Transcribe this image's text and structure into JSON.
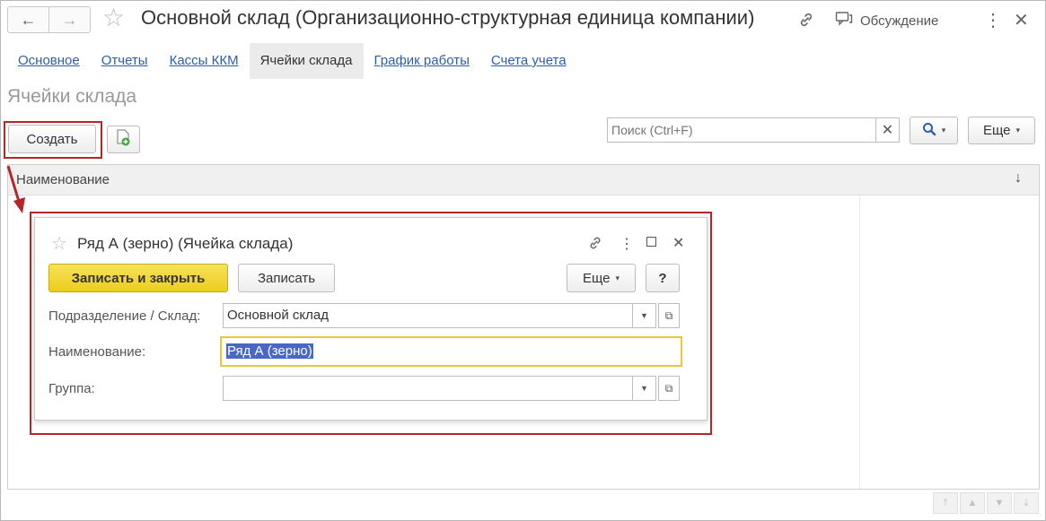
{
  "window": {
    "title": "Основной склад (Организационно-структурная единица компании)",
    "discussion_label": "Обсуждение"
  },
  "tabs": [
    {
      "label": "Основное"
    },
    {
      "label": "Отчеты"
    },
    {
      "label": "Кассы ККМ"
    },
    {
      "label": "Ячейки склада"
    },
    {
      "label": "График работы"
    },
    {
      "label": "Счета учета"
    }
  ],
  "section": {
    "title": "Ячейки склада"
  },
  "toolbar": {
    "create_label": "Создать",
    "search_placeholder": "Поиск (Ctrl+F)",
    "more_label": "Еще"
  },
  "list": {
    "column_header": "Наименование",
    "sort_indicator": "↓"
  },
  "dialog": {
    "title": "Ряд А (зерно) (Ячейка склада)",
    "save_close_label": "Записать и закрыть",
    "save_label": "Записать",
    "more_label": "Еще",
    "help_label": "?",
    "fields": {
      "department_label": "Подразделение / Склад:",
      "department_value": "Основной склад",
      "name_label": "Наименование:",
      "name_value": "Ряд А (зерно)",
      "group_label": "Группа:",
      "group_value": ""
    }
  },
  "colors": {
    "highlight": "#b3272a",
    "link": "#2d5ea8",
    "primary_button": "#f2d733"
  }
}
